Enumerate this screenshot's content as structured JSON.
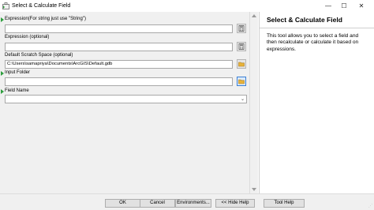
{
  "window": {
    "title": "Select & Calculate Field",
    "minimize": "—",
    "maximize": "☐",
    "close": "✕"
  },
  "form": {
    "expression_string_label": "Expression(For string just use \"String\")",
    "expression_string_value": "",
    "expression_optional_label": "Expression (optional)",
    "expression_optional_value": "",
    "scratch_label": "Default Scratch Space (optional)",
    "scratch_value": "C:\\Users\\samapriya\\Documents\\ArcGIS\\Default.gdb",
    "input_folder_label": "Input Folder",
    "input_folder_value": "",
    "field_name_label": "Field Name",
    "field_name_value": ""
  },
  "help": {
    "title": "Select & Calculate Field",
    "description": "This tool allows you to select a field and then recalculate or calculate it based on expressions."
  },
  "buttons": {
    "ok": "OK",
    "cancel": "Cancel",
    "environments": "Environments...",
    "hide_help": "<< Hide Help",
    "tool_help": "Tool Help"
  },
  "colors": {
    "required_marker": "#2e9e3e",
    "folder_icon": "#e8b339",
    "active_border": "#3b7fd4"
  }
}
